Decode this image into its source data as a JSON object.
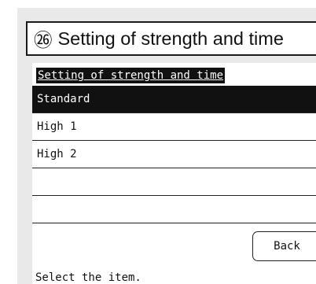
{
  "heading": {
    "number": "㉖",
    "text": "Setting of strength and time"
  },
  "screen": {
    "title": "Setting of strength and time",
    "items": [
      {
        "label": "Standard",
        "selected": true
      },
      {
        "label": "High 1",
        "selected": false
      },
      {
        "label": "High 2",
        "selected": false
      },
      {
        "label": "",
        "selected": false
      },
      {
        "label": "",
        "selected": false
      }
    ],
    "back_label": "Back",
    "status_text": "Select the item."
  }
}
